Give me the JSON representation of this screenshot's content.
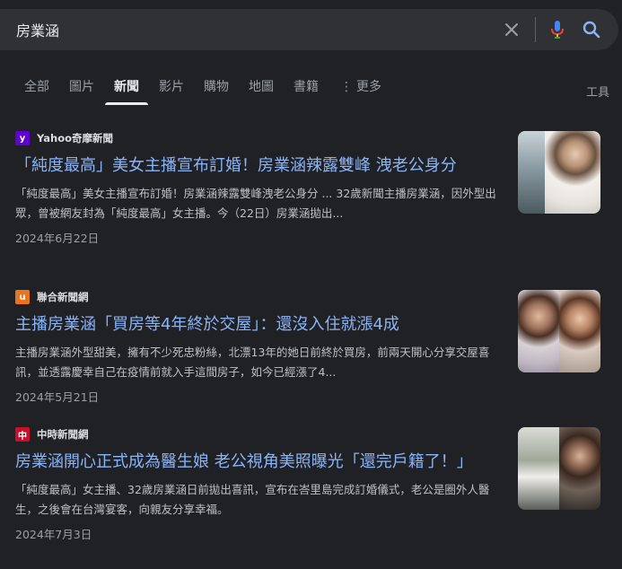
{
  "search": {
    "query": "房業涵"
  },
  "tabs": [
    {
      "label": "全部"
    },
    {
      "label": "圖片"
    },
    {
      "label": "新聞"
    },
    {
      "label": "影片"
    },
    {
      "label": "購物"
    },
    {
      "label": "地圖"
    },
    {
      "label": "書籍"
    },
    {
      "label": "更多"
    }
  ],
  "tools_label": "工具",
  "results": [
    {
      "source": "Yahoo奇摩新聞",
      "source_icon": "y",
      "source_color": "#6001d2",
      "title": "「純度最高」美女主播宣布訂婚！房業涵辣露雙峰 洩老公身分",
      "snippet": "「純度最高」美女主播宣布訂婚！房業涵辣露雙峰洩老公身分 ... 32歲新聞主播房業涵，因外型出眾，曾被網友封為「純度最高」女主播。今（22日）房業涵拋出...",
      "date": "2024年6月22日"
    },
    {
      "source": "聯合新聞網",
      "source_icon": "u",
      "source_color": "#e8741e",
      "title": "主播房業涵「買房等4年終於交屋」：還沒入住就漲4成",
      "snippet": "主播房業涵外型甜美，擁有不少死忠粉絲，北漂13年的她日前終於買房，前兩天開心分享交屋喜訊，並透露慶幸自己在疫情前就入手這間房子，如今已經漲了4...",
      "date": "2024年5月21日"
    },
    {
      "source": "中時新聞網",
      "source_icon": "中",
      "source_color": "#c8102e",
      "title": "房業涵開心正式成為醫生娘 老公視角美照曝光「還完戶籍了！」",
      "snippet": "「純度最高」女主播、32歲房業涵日前拋出喜訊，宣布在峇里島完成訂婚儀式，老公是圈外人醫生，之後會在台灣宴客，向親友分享幸福。",
      "date": "2024年7月3日"
    }
  ]
}
